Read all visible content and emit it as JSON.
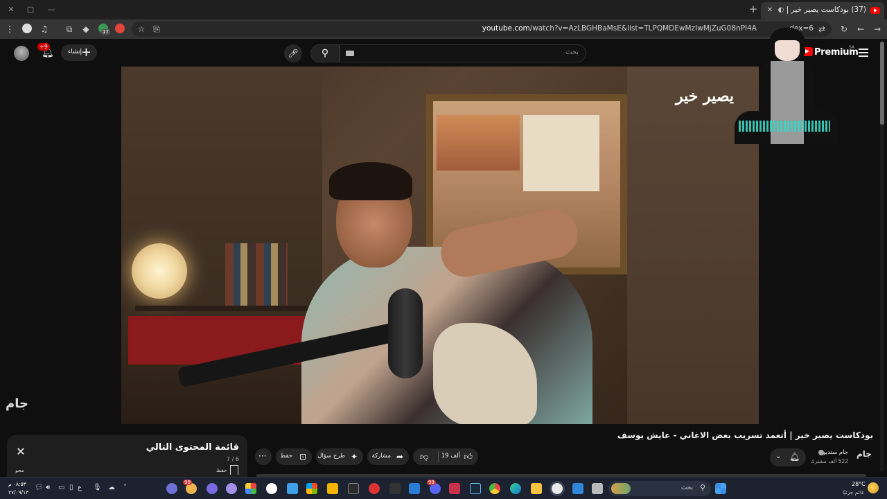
{
  "browser": {
    "tab_title": "(37) بودكاست يصير خير | أتـ",
    "tab_badge": "37",
    "url_domain": "youtube.com",
    "url_path": "/watch?v=AzLBGHBaMsE&list=TLPQMDEwMzIwMjZuG08nPI4A",
    "url_tail": "dex=6",
    "extension_badge": "17",
    "window_controls": {
      "minimize": "—",
      "maximize": "▢",
      "tab_close": "✕",
      "new_tab": "+"
    }
  },
  "youtube": {
    "logo_text": "Premium",
    "region": "SA",
    "search_placeholder": "بحث",
    "create_label": "إنشاء",
    "notification_count": "+9"
  },
  "video": {
    "brand_overlay": "يصير خير",
    "channel_watermark": "جام",
    "title": "بودكاست يصير خير | أتعمد تسريب بعض الاغاني - عايش يوسف"
  },
  "channel": {
    "name": "جام ستديو",
    "subscribers": "522 ألف مشترك",
    "avatar_text": "جام"
  },
  "actions": {
    "likes": "19 ألف",
    "share": "مشاركة",
    "ask": "طرح سؤال",
    "save": "حفظ",
    "more": "···"
  },
  "playlist": {
    "title": "قائمة المحتوى التالي",
    "position": "7 / 6",
    "save": "حفظ",
    "loop": "محو"
  },
  "taskbar": {
    "search_label": "بحث",
    "weather_temp": "28°C",
    "weather_desc": "غائم جزئيًا",
    "time": "٠٨:٥٣ م",
    "date": "٢٧/٠٩/١٣",
    "lang": "ع",
    "badge_a": "99",
    "badge_b": "99"
  },
  "colors": {
    "yt_red": "#ff0000",
    "bg": "#0f0f0f",
    "chip": "#272727",
    "taskbar": "#1c2230"
  }
}
